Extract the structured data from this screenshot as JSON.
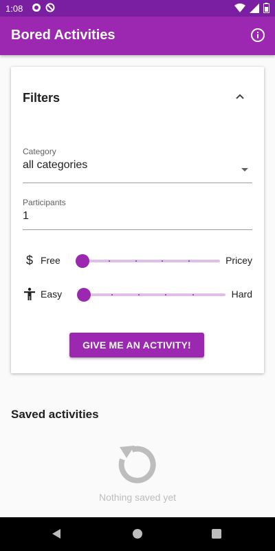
{
  "status": {
    "time": "1:08",
    "icons": [
      "gear-icon",
      "do-not-disturb-icon",
      "wifi-icon",
      "signal-icon",
      "battery-icon"
    ]
  },
  "appbar": {
    "title": "Bored Activities",
    "info_icon": "info-icon"
  },
  "filters": {
    "title": "Filters",
    "toggle_icon": "chevron-up-icon",
    "category": {
      "label": "Category",
      "value": "all categories"
    },
    "participants": {
      "label": "Participants",
      "value": "1"
    },
    "price": {
      "icon": "dollar-icon",
      "min_label": "Free",
      "max_label": "Pricey",
      "value_fraction": 0.0
    },
    "accessibility": {
      "icon": "person-icon",
      "min_label": "Easy",
      "max_label": "Hard",
      "value_fraction": 0.0
    },
    "button_label": "GIVE ME AN ACTIVITY!"
  },
  "saved": {
    "title": "Saved activities",
    "empty_icon": "reload-icon",
    "empty_text": "Nothing saved yet"
  },
  "colors": {
    "status_bar": "#7b1fa2",
    "app_bar": "#9c27b0",
    "accent": "#9c27b0",
    "track": "#e1bee7"
  }
}
